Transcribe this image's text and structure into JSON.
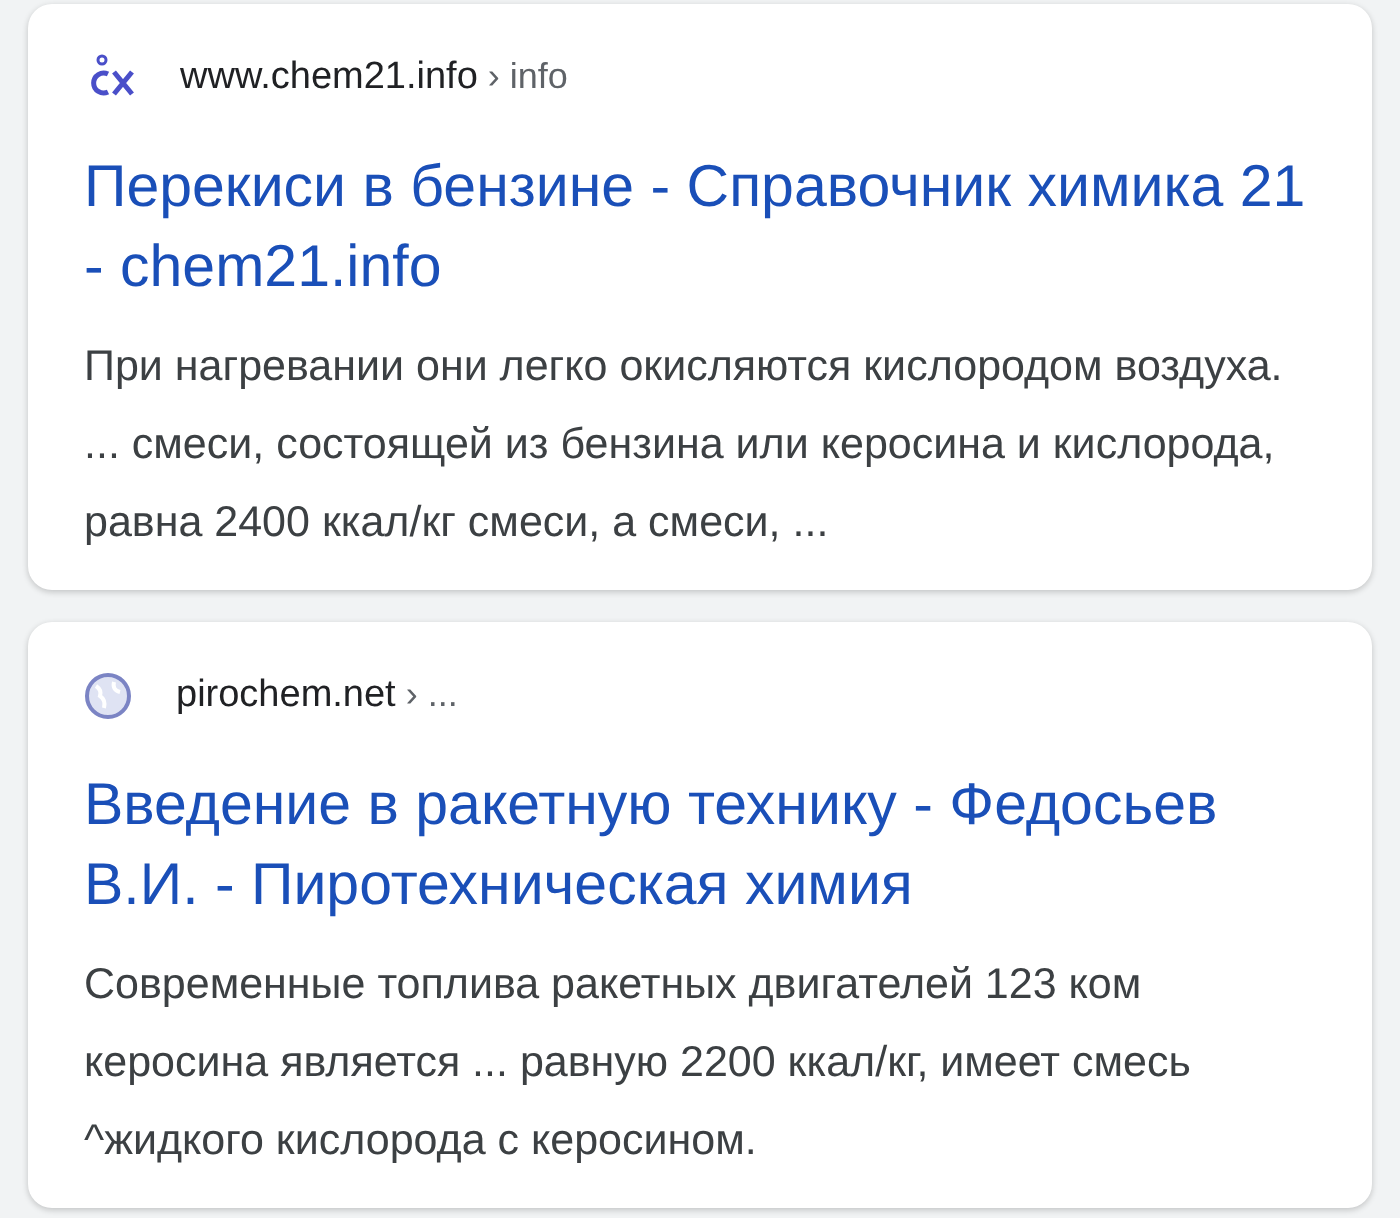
{
  "results": [
    {
      "kind": "logo",
      "site": "www.chem21.info",
      "path": "› info",
      "title": "Перекиси в бензине - Справочник химика 21 - chem21.info",
      "snippet": "При нагревании они легко окисляются кислородом воздуха. ... смеси, состоящей из бензина или керосина и кислорода, равна 2400 ккал/кг смеси, а смеси, ..."
    },
    {
      "kind": "globe",
      "site": "pirochem.net",
      "path": "› ...",
      "title": "Введение в ракетную технику - Федосьев В.И. - Пиротехническая химия",
      "snippet": "Современные топлива ракетных двигателей 123 ком керосина является ... равную 2200 ккал/кг, имеет смесь ^жидкого кислорода с керосином."
    }
  ]
}
